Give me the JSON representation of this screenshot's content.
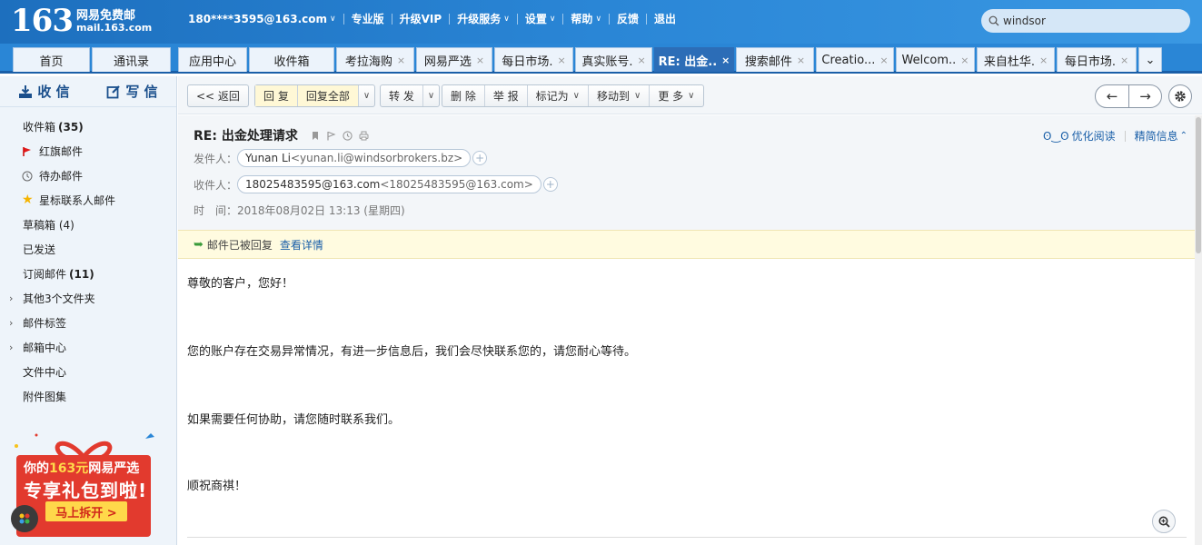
{
  "brand": {
    "number": "163",
    "name": "网易免费邮",
    "domain": "mail.163.com"
  },
  "topnav": {
    "account": "180****3595@163.com",
    "items": [
      "专业版",
      "升级VIP",
      "升级服务",
      "设置",
      "帮助",
      "反馈",
      "退出"
    ]
  },
  "search": {
    "value": "windsor"
  },
  "tabs": [
    {
      "label": "首页"
    },
    {
      "label": "通讯录"
    },
    {
      "label": "应用中心"
    },
    {
      "label": "收件箱"
    },
    {
      "label": "考拉海购",
      "x": "×"
    },
    {
      "label": "网易严选",
      "x": "×"
    },
    {
      "label": "每日市场.",
      "x": "×"
    },
    {
      "label": "真实账号.",
      "x": "×"
    },
    {
      "label": "RE: 出金..",
      "x": "×"
    },
    {
      "label": "搜索邮件",
      "x": "×"
    },
    {
      "label": "Creatio...",
      "x": "×"
    },
    {
      "label": "Welcom..",
      "x": "×"
    },
    {
      "label": "来自杜华.",
      "x": "×"
    },
    {
      "label": "每日市场.",
      "x": "×"
    },
    {
      "label": "⌄"
    }
  ],
  "sidebar": {
    "receive_label": "收 信",
    "compose_label": "写 信",
    "folders": {
      "inbox": {
        "label": "收件箱",
        "count": "(35)"
      },
      "flagged": "红旗邮件",
      "todo": "待办邮件",
      "starred": "星标联系人邮件",
      "drafts": "草稿箱 (4)",
      "sent": "已发送",
      "subscriptions": {
        "label": "订阅邮件",
        "count": "(11)"
      },
      "other": "其他3个文件夹",
      "tags": "邮件标签",
      "center": "邮箱中心",
      "files": "文件中心",
      "attachments": "附件图集"
    },
    "promo": {
      "line1_pre": "你的",
      "line1_hl": "163元",
      "line1_post": "网易严选",
      "line2": "专享礼包到啦!",
      "button": "马上拆开 >"
    }
  },
  "toolbar": {
    "back": "<< 返回",
    "reply": "回 复",
    "reply_all": "回复全部",
    "forward": "转 发",
    "delete": "删 除",
    "report": "举 报",
    "mark_as": "标记为",
    "move_to": "移动到",
    "more": "更 多"
  },
  "email": {
    "subject": "RE: 出金处理请求",
    "from_label": "发件人：",
    "from_name": "Yunan Li",
    "from_addr": "<yunan.li@windsorbrokers.bz>",
    "to_label": "收件人：",
    "to_name": "18025483595@163.com",
    "to_addr": "<18025483595@163.com>",
    "time_label": "时　间：",
    "time_value": "2018年08月02日 13:13 (星期四)",
    "read_mode": "优化阅读",
    "brief_info": "精简信息",
    "notice": "邮件已被回复",
    "notice_link": "查看详情",
    "body": [
      "尊敬的客户，您好！",
      "您的账户存在交易异常情况，有进一步信息后，我们会尽快联系您的，请您耐心等待。",
      "如果需要任何协助，请您随时联系我们。",
      "顺祝商祺！"
    ]
  }
}
